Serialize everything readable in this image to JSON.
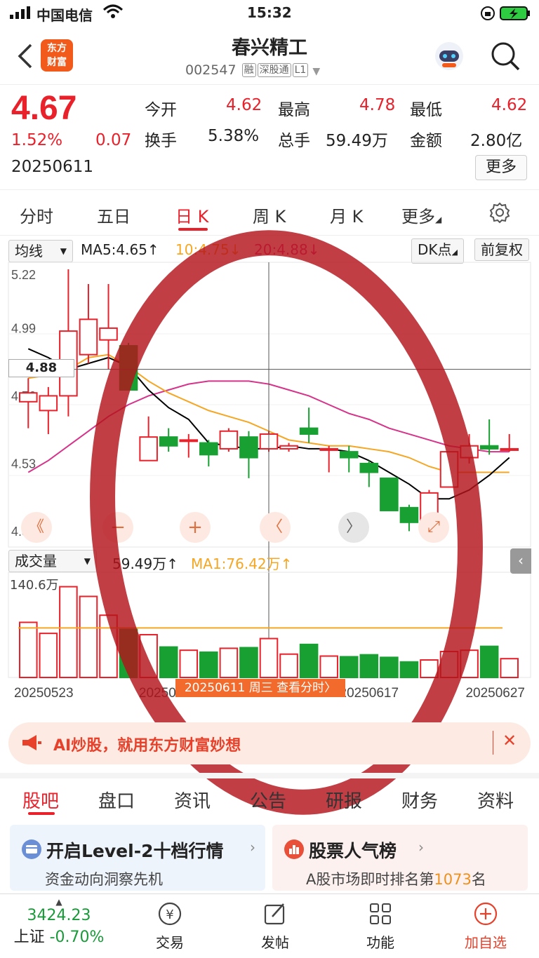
{
  "status_bar": {
    "carrier": "中国电信",
    "time": "15:32"
  },
  "header": {
    "back_icon": "chevron-left-icon",
    "logo_text_line1": "东方",
    "logo_text_line2": "财富",
    "title": "春兴精工",
    "code": "002547",
    "tags": [
      "融",
      "深股通",
      "L1"
    ]
  },
  "quote": {
    "price": "4.67",
    "change_pct": "1.52%",
    "change": "0.07",
    "date": "20250611",
    "stats": [
      {
        "label": "今开",
        "value": "4.62",
        "color": "red"
      },
      {
        "label": "最高",
        "value": "4.78",
        "color": "red"
      },
      {
        "label": "最低",
        "value": "4.62",
        "color": "red"
      },
      {
        "label": "换手",
        "value": "5.38%",
        "color": "black"
      },
      {
        "label": "总手",
        "value": "59.49万",
        "color": "black"
      },
      {
        "label": "金额",
        "value": "2.80亿",
        "color": "black"
      }
    ],
    "more_label": "更多"
  },
  "chart_tabs": [
    "分时",
    "五日",
    "日 K",
    "周 K",
    "月 K",
    "更多"
  ],
  "chart_tabs_active": 2,
  "ma_bar": {
    "selector": "均线",
    "ma5": "MA5:4.65↑",
    "ma10": "10:4.75↓",
    "ma20": "20:4.88↓",
    "dk": "DK点",
    "adjust": "前复权"
  },
  "chart_data": {
    "type": "candlestick",
    "y_ticks": [
      "5.22",
      "4.99",
      "4.76",
      "4.53",
      "4.30"
    ],
    "ylim": [
      4.3,
      5.22
    ],
    "crosshair_value": "4.88",
    "candles": [
      {
        "o": 4.77,
        "c": 4.8,
        "h": 4.85,
        "l": 4.68
      },
      {
        "o": 4.74,
        "c": 4.79,
        "h": 4.82,
        "l": 4.66
      },
      {
        "o": 4.79,
        "c": 5.01,
        "h": 5.22,
        "l": 4.72
      },
      {
        "o": 4.93,
        "c": 5.05,
        "h": 5.17,
        "l": 4.9
      },
      {
        "o": 4.98,
        "c": 5.02,
        "h": 5.17,
        "l": 4.88
      },
      {
        "o": 4.96,
        "c": 4.81,
        "h": 4.97,
        "l": 4.81
      },
      {
        "o": 4.57,
        "c": 4.65,
        "h": 4.72,
        "l": 4.57
      },
      {
        "o": 4.65,
        "c": 4.62,
        "h": 4.68,
        "l": 4.6
      },
      {
        "o": 4.64,
        "c": 4.64,
        "h": 4.66,
        "l": 4.58
      },
      {
        "o": 4.63,
        "c": 4.59,
        "h": 4.64,
        "l": 4.55
      },
      {
        "o": 4.61,
        "c": 4.67,
        "h": 4.68,
        "l": 4.6
      },
      {
        "o": 4.65,
        "c": 4.58,
        "h": 4.67,
        "l": 4.51
      },
      {
        "o": 4.61,
        "c": 4.66,
        "h": 4.67,
        "l": 4.6
      },
      {
        "o": 4.61,
        "c": 4.62,
        "h": 4.63,
        "l": 4.6
      },
      {
        "o": 4.68,
        "c": 4.66,
        "h": 4.75,
        "l": 4.63
      },
      {
        "o": 4.61,
        "c": 4.61,
        "h": 4.62,
        "l": 4.53
      },
      {
        "o": 4.6,
        "c": 4.58,
        "h": 4.62,
        "l": 4.53
      },
      {
        "o": 4.56,
        "c": 4.53,
        "h": 4.57,
        "l": 4.48
      },
      {
        "o": 4.51,
        "c": 4.4,
        "h": 4.51,
        "l": 4.4
      },
      {
        "o": 4.41,
        "c": 4.36,
        "h": 4.42,
        "l": 4.33
      },
      {
        "o": 4.34,
        "c": 4.46,
        "h": 4.47,
        "l": 4.3
      },
      {
        "o": 4.48,
        "c": 4.6,
        "h": 4.6,
        "l": 4.48
      },
      {
        "o": 4.58,
        "c": 4.62,
        "h": 4.66,
        "l": 4.56
      },
      {
        "o": 4.62,
        "c": 4.61,
        "h": 4.71,
        "l": 4.59
      },
      {
        "o": 4.61,
        "c": 4.61,
        "h": 4.66,
        "l": 4.6
      }
    ],
    "ma5": [
      4.95,
      4.92,
      4.88,
      4.9,
      4.92,
      4.89,
      4.81,
      4.75,
      4.71,
      4.63,
      4.62,
      4.61,
      4.61,
      4.62,
      4.61,
      4.61,
      4.6,
      4.57,
      4.53,
      4.49,
      4.44,
      4.44,
      4.47,
      4.52,
      4.58
    ],
    "ma10": [
      4.85,
      4.86,
      4.88,
      4.92,
      4.93,
      4.89,
      4.84,
      4.8,
      4.77,
      4.74,
      4.72,
      4.7,
      4.67,
      4.64,
      4.63,
      4.62,
      4.62,
      4.61,
      4.6,
      4.58,
      4.55,
      4.53,
      4.53,
      4.53,
      4.53
    ],
    "ma20": [
      4.53,
      4.57,
      4.62,
      4.67,
      4.72,
      4.76,
      4.79,
      4.81,
      4.83,
      4.84,
      4.84,
      4.84,
      4.83,
      4.81,
      4.79,
      4.76,
      4.73,
      4.71,
      4.68,
      4.66,
      4.64,
      4.62,
      4.61,
      4.6,
      4.6
    ],
    "crosshair_index": 12,
    "volume_label": "成交量",
    "volume_value": "59.49万↑",
    "volume_ma": "MA1:76.42万↑",
    "volume_max_label": "140.6万",
    "volume_max": 140.6,
    "volume_ma_value": 76.42,
    "volumes": [
      85,
      68,
      140,
      125,
      96,
      74,
      66,
      47,
      42,
      39,
      45,
      46,
      60,
      36,
      51,
      33,
      32,
      35,
      31,
      24,
      27,
      40,
      42,
      48,
      29
    ],
    "x_ticks": [
      "20250523",
      "20250606",
      "20250617",
      "20250627"
    ],
    "x_tick_indices": [
      0,
      7,
      17,
      24
    ],
    "tooltip": "20250611 周三 查看分时",
    "colors": {
      "up": "#e8212b",
      "down": "#18a032",
      "ma5": "#000000",
      "ma10": "#f5a623",
      "ma20": "#d6338a"
    }
  },
  "chart_controls": [
    "《",
    "−",
    "+",
    "〈",
    "〉",
    "⤢"
  ],
  "banner": {
    "text": "AI炒股，就用东方财富妙想"
  },
  "bottom_tabs": [
    "股吧",
    "盘口",
    "资讯",
    "公告",
    "研报",
    "财务",
    "资料"
  ],
  "cards": [
    {
      "title": "开启Level-2十档行情",
      "sub": "资金动向洞察先机"
    },
    {
      "title": "股票人气榜",
      "sub_prefix": "A股市场即时排名第",
      "rank": "1073",
      "sub_suffix": "名"
    }
  ],
  "bottom_nav": {
    "index_value": "3424.23",
    "index_name": "上证",
    "index_change": "-0.70%",
    "items": [
      "交易",
      "发帖",
      "功能",
      "加自选"
    ]
  }
}
